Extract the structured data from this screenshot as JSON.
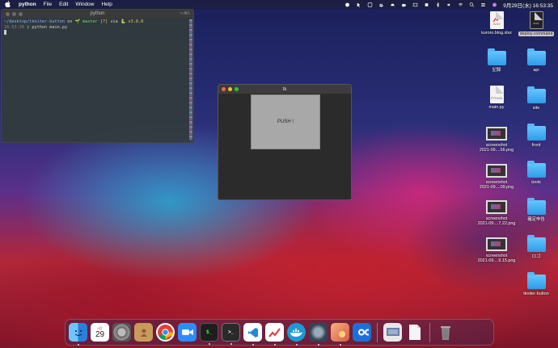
{
  "menubar": {
    "app_name": "python",
    "menus": [
      "File",
      "Edit",
      "Window",
      "Help"
    ],
    "datetime": "9月29日(水) 16:53:35"
  },
  "terminal": {
    "title": "python",
    "tag": "⌥⌘1",
    "lines": {
      "path": "~/desktop/tkniter-button",
      "on": "on",
      "branch_icon": "🌱",
      "branch": "master",
      "status": "[?]",
      "via": "via",
      "python_icon": "🐍",
      "python_version": "v3.8.8",
      "time": "16:53:26",
      "prompt": "❯",
      "command": "python main.py"
    }
  },
  "tk_window": {
    "title": "tk",
    "button_label": "PUSH !"
  },
  "desktop_icons": [
    {
      "label": "kuroro.blog.xlsx",
      "kind": "file",
      "file_text": "XLSX"
    },
    {
      "label": "deploy.command",
      "kind": "file-dark",
      "file_text": "exec",
      "selected": true
    },
    {
      "label": "記録",
      "kind": "folder"
    },
    {
      "label": "api",
      "kind": "folder"
    },
    {
      "label": "main.py",
      "kind": "file",
      "file_text": "PYTHON"
    },
    {
      "label": "site",
      "kind": "folder"
    },
    {
      "label": "screenshot\n2021-09....56.png",
      "kind": "shot"
    },
    {
      "label": "front",
      "kind": "folder"
    },
    {
      "label": "screenshot\n2021-09....09.png",
      "kind": "shot"
    },
    {
      "label": "tools",
      "kind": "folder"
    },
    {
      "label": "screenshot\n2021-09....7.22.png",
      "kind": "shot"
    },
    {
      "label": "確定申告",
      "kind": "folder"
    },
    {
      "label": "screenshot\n2021-09....9.15.png",
      "kind": "shot"
    },
    {
      "label": "ロゴ",
      "kind": "folder"
    },
    {
      "label": "tkniter-button",
      "kind": "folder"
    }
  ],
  "dock": {
    "calendar_month": "9月",
    "calendar_day": "29",
    "apps": [
      {
        "name": "finder-icon",
        "color": "#3a8ee6"
      },
      {
        "name": "calendar-icon",
        "color": "#ffffff"
      },
      {
        "name": "system-preferences-icon",
        "color": "#8a8a8a"
      },
      {
        "name": "contacts-icon",
        "color": "#c99a5b"
      },
      {
        "name": "chrome-icon",
        "color": "#ffffff"
      },
      {
        "name": "zoom-icon",
        "color": "#2d8cff"
      },
      {
        "name": "terminal-green-icon",
        "color": "#1e1e1e"
      },
      {
        "name": "terminal-icon",
        "color": "#2a2a2a"
      },
      {
        "name": "vscode-icon",
        "color": "#ffffff"
      },
      {
        "name": "graph-app-icon",
        "color": "#ffffff"
      },
      {
        "name": "docker-icon",
        "color": "#1d9ad6"
      },
      {
        "name": "quicktime-icon",
        "color": "#4a5a6a"
      },
      {
        "name": "preview-icon",
        "color": "#e58a60"
      },
      {
        "name": "infinity-app-icon",
        "color": "#1e6fd9"
      }
    ]
  }
}
